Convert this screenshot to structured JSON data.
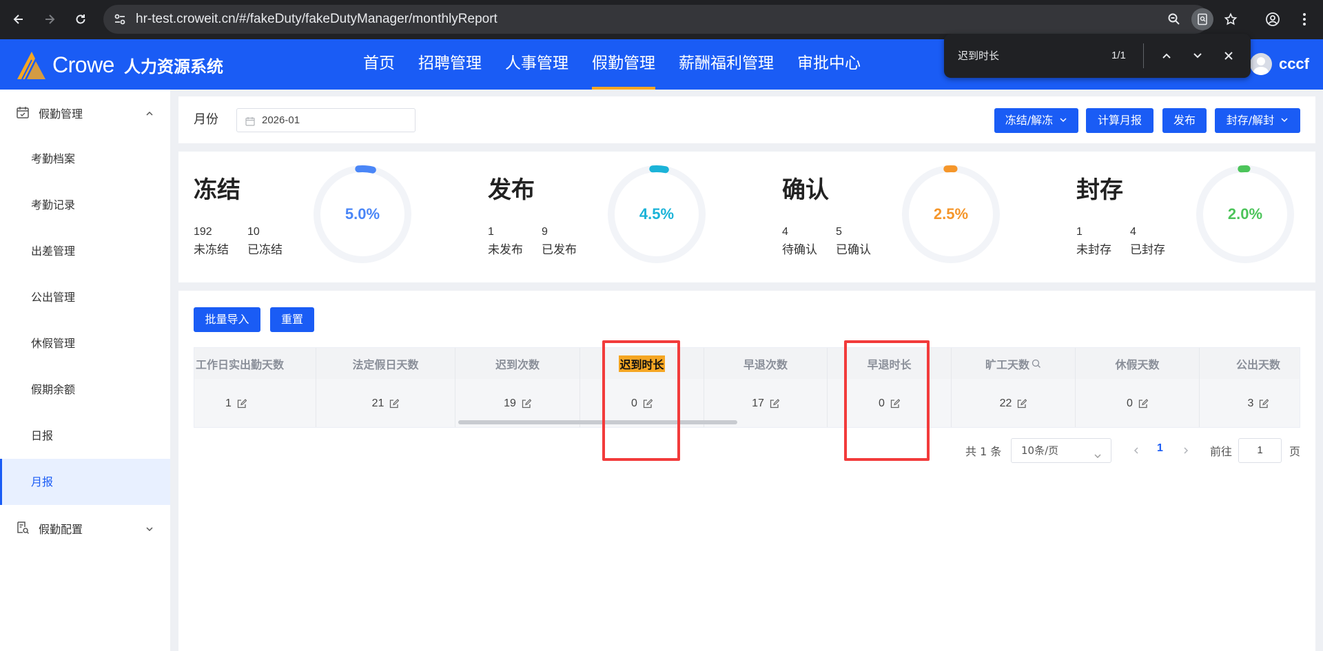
{
  "browser": {
    "url": "hr-test.croweit.cn/#/fakeDuty/fakeDutyManager/monthlyReport"
  },
  "find_bar": {
    "query": "迟到时长",
    "count": "1/1"
  },
  "header": {
    "logo_text": "Crowe",
    "system_name": "人力资源系统",
    "nav": [
      "首页",
      "招聘管理",
      "人事管理",
      "假勤管理",
      "薪酬福利管理",
      "审批中心"
    ],
    "active_nav": "假勤管理",
    "user": "cccf"
  },
  "sidebar": {
    "group1": "假勤管理",
    "items": [
      "考勤档案",
      "考勤记录",
      "出差管理",
      "公出管理",
      "休假管理",
      "假期余额",
      "日报",
      "月报"
    ],
    "active_item": "月报",
    "group2": "假勤配置"
  },
  "filter": {
    "month_label": "月份",
    "month_value": "2026-01",
    "buttons": {
      "freeze": "冻结/解冻",
      "calc": "计算月报",
      "publish": "发布",
      "seal": "封存/解封"
    }
  },
  "stats": [
    {
      "title": "冻结",
      "n1": "192",
      "l1": "未冻结",
      "n2": "10",
      "l2": "已冻结",
      "pct": "5.0%",
      "value": 5.0,
      "color": "#4a86f7"
    },
    {
      "title": "发布",
      "n1": "1",
      "l1": "未发布",
      "n2": "9",
      "l2": "已发布",
      "pct": "4.5%",
      "value": 4.5,
      "color": "#1bb3d8"
    },
    {
      "title": "确认",
      "n1": "4",
      "l1": "待确认",
      "n2": "5",
      "l2": "已确认",
      "pct": "2.5%",
      "value": 2.5,
      "color": "#f5962a"
    },
    {
      "title": "封存",
      "n1": "1",
      "l1": "未封存",
      "n2": "4",
      "l2": "已封存",
      "pct": "2.0%",
      "value": 2.0,
      "color": "#4cc45a"
    }
  ],
  "table": {
    "buttons": {
      "import": "批量导入",
      "reset": "重置"
    },
    "headers": [
      "工作日实出勤天数",
      "法定假日天数",
      "迟到次数",
      "迟到时长",
      "早退次数",
      "早退时长",
      "旷工天数",
      "休假天数",
      "公出天数"
    ],
    "row": [
      "1",
      "21",
      "19",
      "0",
      "17",
      "0",
      "22",
      "0",
      "3"
    ]
  },
  "pagination": {
    "total": "共 1 条",
    "page_size": "10条/页",
    "current_page": "1",
    "goto_label": "前往",
    "goto_value": "1",
    "page_suffix": "页"
  }
}
